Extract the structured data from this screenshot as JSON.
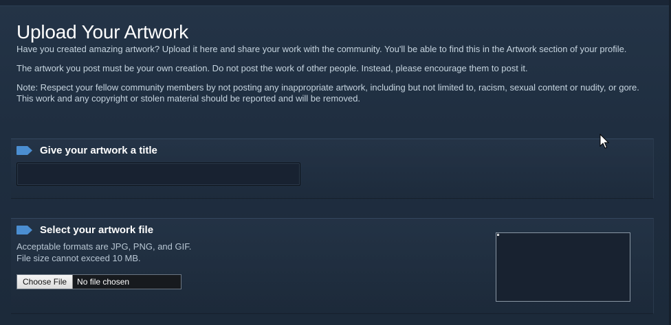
{
  "page": {
    "title": "Upload Your Artwork",
    "intro": "Have you created amazing artwork? Upload it here and share your work with the community. You'll be able to find this in the Artwork section of your profile.",
    "rule": "The artwork you post must be your own creation. Do not post the work of other people. Instead, please encourage them to post it.",
    "note": "Note: Respect your fellow community members by not posting any inappropriate artwork, including but not limited to, racism, sexual content or nudity, or gore. This work and any copyright or stolen material should be reported and will be removed."
  },
  "title_section": {
    "heading": "Give your artwork a title",
    "input_value": "",
    "input_placeholder": ""
  },
  "file_section": {
    "heading": "Select your artwork file",
    "formats": "Acceptable formats are JPG, PNG, and GIF.",
    "size_limit": "File size cannot exceed 10 MB.",
    "choose_button": "Choose File",
    "file_status": "No file chosen"
  },
  "colors": {
    "background": "#1b2838",
    "accent_arrow": "#4b8ed1",
    "text": "#c6d4df"
  },
  "icons": {
    "section_marker": "arrow-tag-icon",
    "cursor": "mouse-pointer-icon"
  }
}
